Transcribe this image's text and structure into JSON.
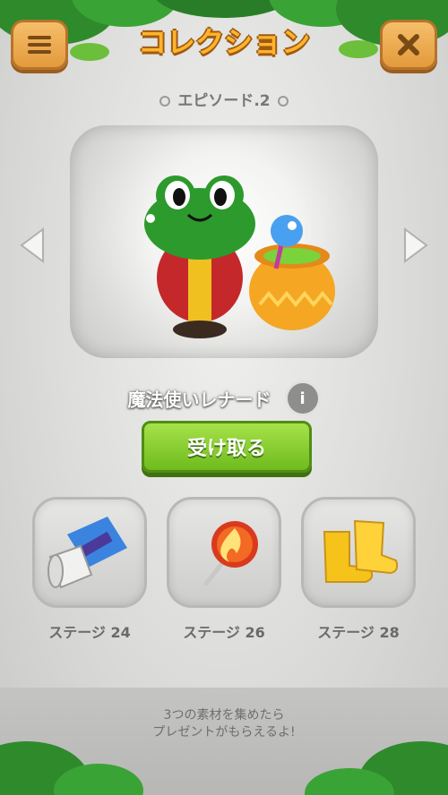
{
  "header": {
    "title": "コレクション",
    "menu_icon": "menu-icon",
    "close_icon": "close-icon"
  },
  "episode": "エピソード.2",
  "character": {
    "name": "魔法使いレナード",
    "info_label": "i"
  },
  "receive_button": "受け取る",
  "items": [
    {
      "stage": "ステージ 24",
      "icon": "scroll-icon"
    },
    {
      "stage": "ステージ 26",
      "icon": "fire-wand-icon"
    },
    {
      "stage": "ステージ 28",
      "icon": "yellow-boots-icon"
    }
  ],
  "hint": {
    "line1": "3つの素材を集めたら",
    "line2": "プレゼントがもらえるよ!"
  },
  "colors": {
    "title": "#ffb42b",
    "button_green": "#7cc324",
    "header_button": "#f0ad56",
    "frog": "#2c9a2c"
  }
}
